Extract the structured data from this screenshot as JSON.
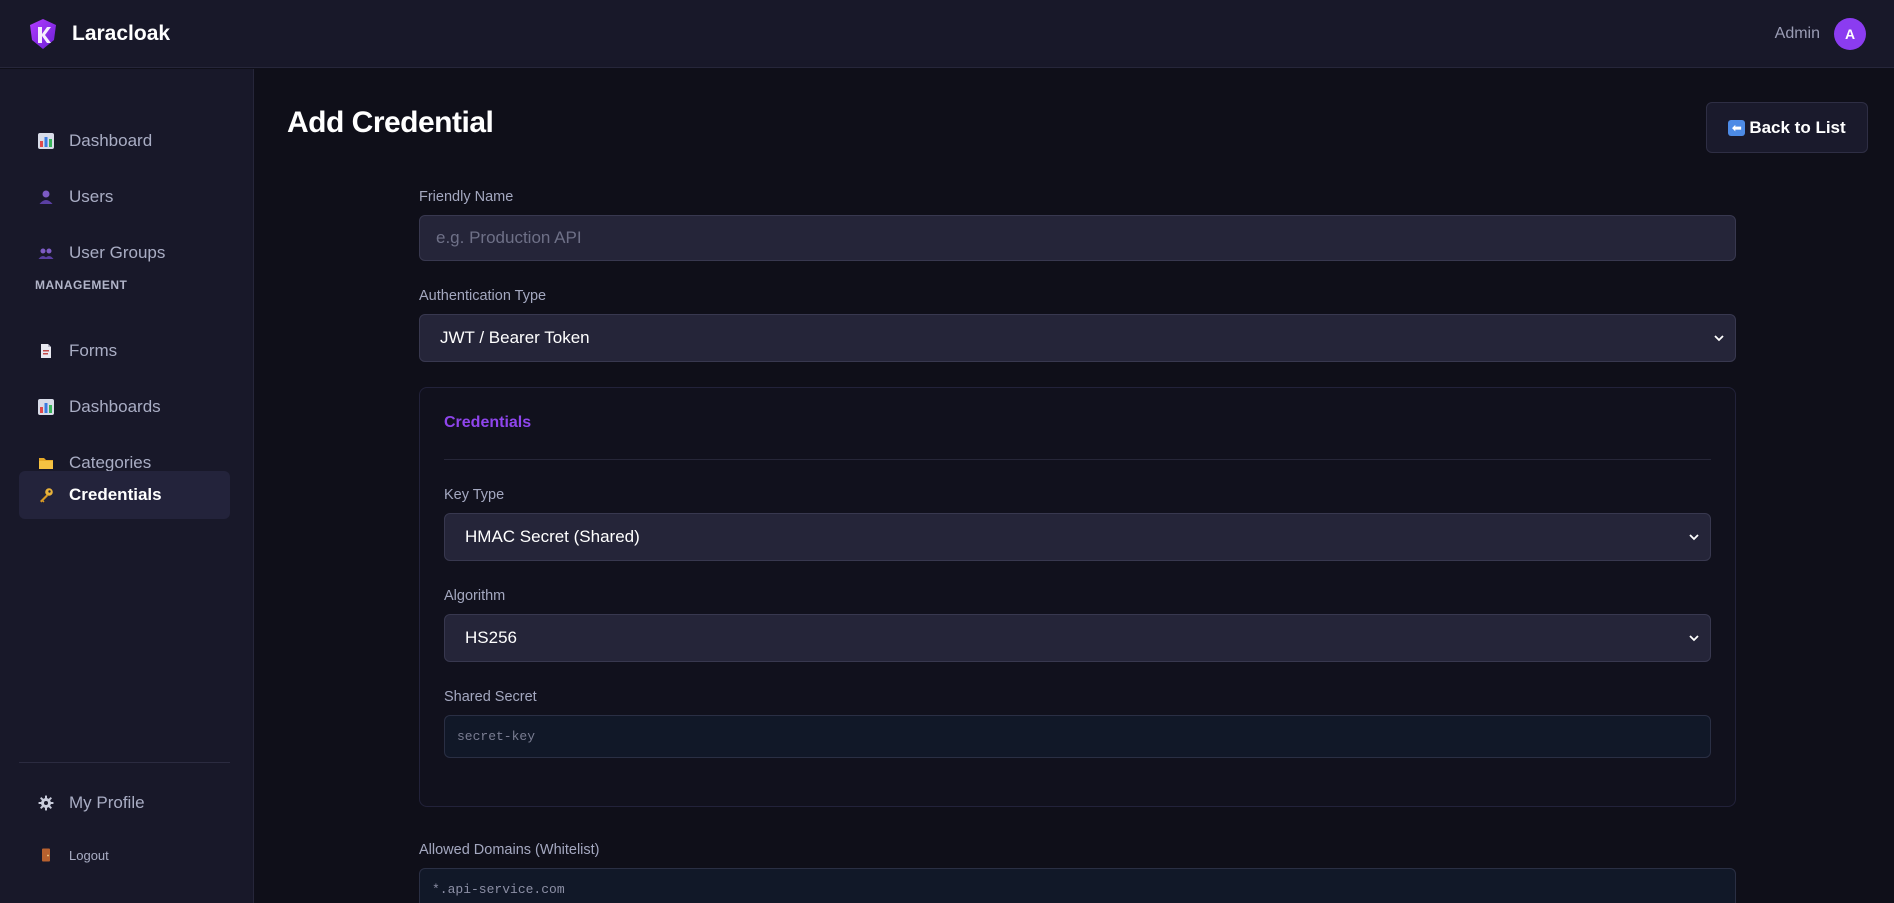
{
  "header": {
    "app_name": "Laracloak",
    "user_name": "Admin",
    "avatar_initial": "A"
  },
  "sidebar": {
    "items": [
      {
        "label": "Dashboard",
        "icon": "bar-chart-icon"
      },
      {
        "label": "Users",
        "icon": "user-icon"
      },
      {
        "label": "User Groups",
        "icon": "users-icon"
      }
    ],
    "section_label": "MANAGEMENT",
    "management_items": [
      {
        "label": "Forms",
        "icon": "document-icon"
      },
      {
        "label": "Dashboards",
        "icon": "bar-chart-icon"
      },
      {
        "label": "Categories",
        "icon": "folder-icon"
      },
      {
        "label": "Credentials",
        "icon": "key-icon",
        "active": true
      }
    ],
    "footer_items": [
      {
        "label": "My Profile",
        "icon": "gear-icon"
      },
      {
        "label": "Logout",
        "icon": "door-icon"
      }
    ]
  },
  "main": {
    "title": "Add Credential",
    "back_button": "Back to List",
    "friendly_name": {
      "label": "Friendly Name",
      "placeholder": "e.g. Production API",
      "value": ""
    },
    "auth_type": {
      "label": "Authentication Type",
      "selected": "JWT / Bearer Token"
    },
    "credentials_card": {
      "title": "Credentials",
      "key_type": {
        "label": "Key Type",
        "selected": "HMAC Secret (Shared)"
      },
      "algorithm": {
        "label": "Algorithm",
        "selected": "HS256"
      },
      "shared_secret": {
        "label": "Shared Secret",
        "placeholder": "secret-key",
        "value": ""
      }
    },
    "allowed_domains": {
      "label": "Allowed Domains (Whitelist)",
      "placeholder": "*.api-service.com"
    }
  },
  "colors": {
    "accent": "#8b3cf0",
    "card_title": "#8f45ec",
    "background": "#0f0f19",
    "sidebar": "#181829"
  }
}
